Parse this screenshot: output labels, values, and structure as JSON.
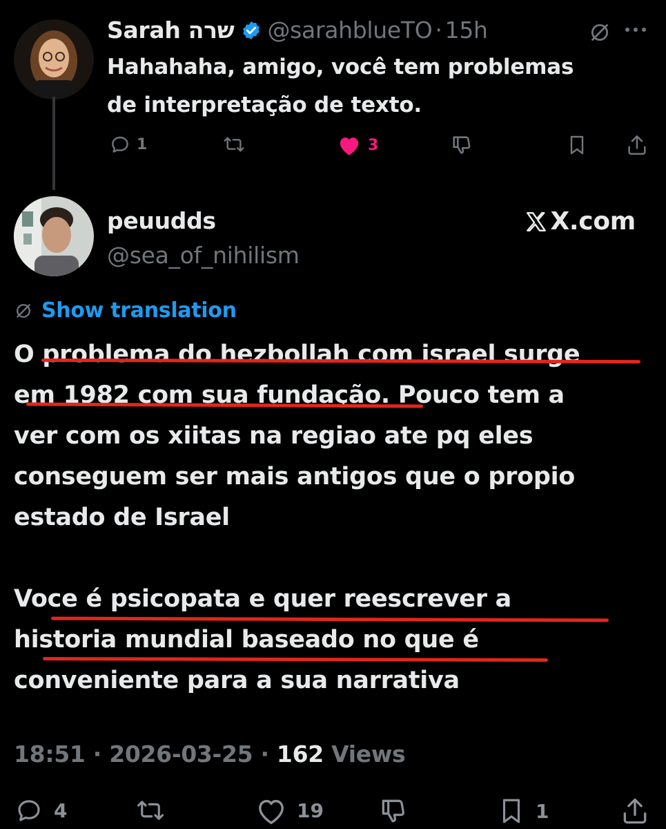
{
  "reply": {
    "display_name": "Sarah שרה",
    "handle": "@sarahblueTO",
    "separator": "·",
    "time": "15h",
    "verified": true,
    "text_lines": [
      "Hahahaha, amigo, você tem problemas",
      "de interpretação de texto."
    ],
    "actions": {
      "reply_count": "1",
      "repost_count": "",
      "like_count": "3",
      "liked": true
    }
  },
  "main": {
    "display_name": "peuudds",
    "handle": "@sea_of_nihilism",
    "source": "X.com",
    "show_translation": "Show translation",
    "text_lines": [
      "O problema do hezbollah com israel surge",
      "em 1982 com sua fundação. Pouco tem a",
      "ver com os xiitas na regiao ate pq eles",
      "conseguem ser mais antigos que o propio",
      "estado de Israel",
      "",
      "Voce é psicopata e quer reescrever a",
      "historia mundial baseado no que é",
      "conveniente para a sua narrativa"
    ],
    "time": "18:51",
    "date": "2026-03-25",
    "views_count": "162",
    "views_label": "Views",
    "actions": {
      "reply_count": "4",
      "repost_count": "",
      "like_count": "19",
      "bookmark_count": "1"
    }
  },
  "colors": {
    "background": "#000000",
    "text": "#e7e9ea",
    "muted": "#71767b",
    "link": "#1d9bf0",
    "like": "#f91880",
    "underline_annotation": "#e3261b"
  }
}
